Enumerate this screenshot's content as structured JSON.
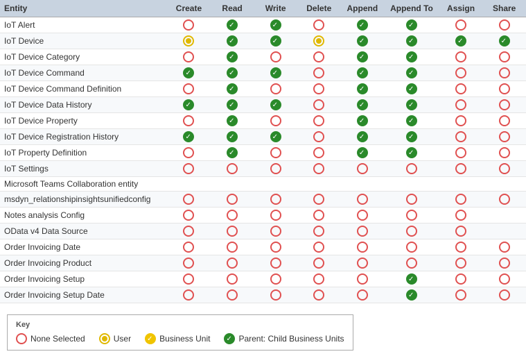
{
  "table": {
    "headers": [
      "Entity",
      "Create",
      "Read",
      "Write",
      "Delete",
      "Append",
      "Append To",
      "Assign",
      "Share"
    ],
    "rows": [
      {
        "entity": "IoT Alert",
        "create": "none",
        "read": "parent",
        "write": "parent",
        "delete": "none",
        "append": "parent",
        "appendTo": "parent",
        "assign": "none",
        "share": "none"
      },
      {
        "entity": "IoT Device",
        "create": "user",
        "read": "parent",
        "write": "parent",
        "delete": "user",
        "append": "parent",
        "appendTo": "parent",
        "assign": "parent",
        "share": "parent"
      },
      {
        "entity": "IoT Device Category",
        "create": "none",
        "read": "parent",
        "write": "none",
        "delete": "none",
        "append": "parent",
        "appendTo": "parent",
        "assign": "none",
        "share": "none"
      },
      {
        "entity": "IoT Device Command",
        "create": "parent",
        "read": "parent",
        "write": "parent",
        "delete": "none",
        "append": "parent",
        "appendTo": "parent",
        "assign": "none",
        "share": "none"
      },
      {
        "entity": "IoT Device Command Definition",
        "create": "none",
        "read": "parent",
        "write": "none",
        "delete": "none",
        "append": "parent",
        "appendTo": "parent",
        "assign": "none",
        "share": "none"
      },
      {
        "entity": "IoT Device Data History",
        "create": "parent",
        "read": "parent",
        "write": "parent",
        "delete": "none",
        "append": "parent",
        "appendTo": "parent",
        "assign": "none",
        "share": "none"
      },
      {
        "entity": "IoT Device Property",
        "create": "none",
        "read": "parent",
        "write": "none",
        "delete": "none",
        "append": "parent",
        "appendTo": "parent",
        "assign": "none",
        "share": "none"
      },
      {
        "entity": "IoT Device Registration History",
        "create": "parent",
        "read": "parent",
        "write": "parent",
        "delete": "none",
        "append": "parent",
        "appendTo": "parent",
        "assign": "none",
        "share": "none"
      },
      {
        "entity": "IoT Property Definition",
        "create": "none",
        "read": "parent",
        "write": "none",
        "delete": "none",
        "append": "parent",
        "appendTo": "parent",
        "assign": "none",
        "share": "none"
      },
      {
        "entity": "IoT Settings",
        "create": "none",
        "read": "none",
        "write": "none",
        "delete": "none",
        "append": "none",
        "appendTo": "none",
        "assign": "none",
        "share": "none"
      },
      {
        "entity": "Microsoft Teams Collaboration entity",
        "create": "",
        "read": "",
        "write": "",
        "delete": "",
        "append": "",
        "appendTo": "",
        "assign": "",
        "share": ""
      },
      {
        "entity": "msdyn_relationshipinsightsunifiedconfig",
        "create": "none",
        "read": "none",
        "write": "none",
        "delete": "none",
        "append": "none",
        "appendTo": "none",
        "assign": "none",
        "share": "none"
      },
      {
        "entity": "Notes analysis Config",
        "create": "none",
        "read": "none",
        "write": "none",
        "delete": "none",
        "append": "none",
        "appendTo": "none",
        "assign": "none",
        "share": ""
      },
      {
        "entity": "OData v4 Data Source",
        "create": "none",
        "read": "none",
        "write": "none",
        "delete": "none",
        "append": "none",
        "appendTo": "none",
        "assign": "none",
        "share": ""
      },
      {
        "entity": "Order Invoicing Date",
        "create": "none",
        "read": "none",
        "write": "none",
        "delete": "none",
        "append": "none",
        "appendTo": "none",
        "assign": "none",
        "share": "none"
      },
      {
        "entity": "Order Invoicing Product",
        "create": "none",
        "read": "none",
        "write": "none",
        "delete": "none",
        "append": "none",
        "appendTo": "none",
        "assign": "none",
        "share": "none"
      },
      {
        "entity": "Order Invoicing Setup",
        "create": "none",
        "read": "none",
        "write": "none",
        "delete": "none",
        "append": "none",
        "appendTo": "parent",
        "assign": "none",
        "share": "none"
      },
      {
        "entity": "Order Invoicing Setup Date",
        "create": "none",
        "read": "none",
        "write": "none",
        "delete": "none",
        "append": "none",
        "appendTo": "parent",
        "assign": "none",
        "share": "none"
      }
    ]
  },
  "key": {
    "title": "Key",
    "items": [
      {
        "type": "none",
        "label": "None Selected"
      },
      {
        "type": "user",
        "label": "User"
      },
      {
        "type": "business",
        "label": "Business Unit"
      },
      {
        "type": "parent",
        "label": "Parent: Child Business Units"
      }
    ]
  }
}
